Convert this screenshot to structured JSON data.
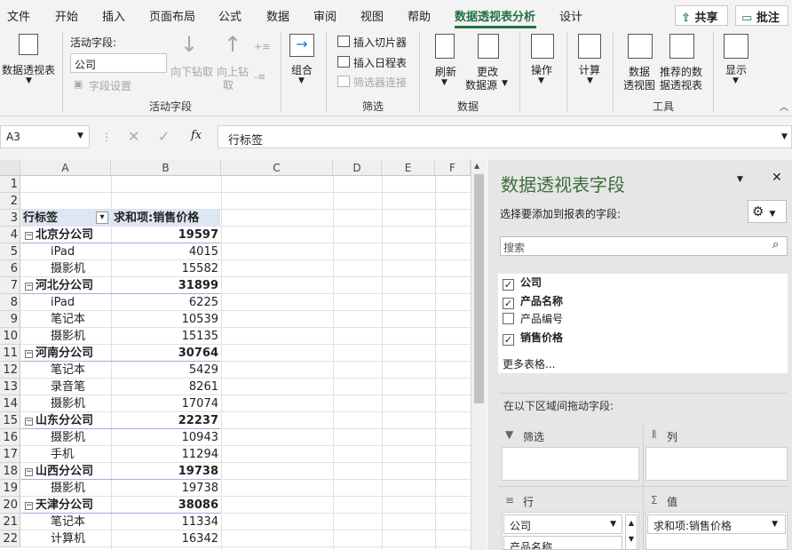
{
  "ribbon_tabs": [
    "文件",
    "开始",
    "插入",
    "页面布局",
    "公式",
    "数据",
    "审阅",
    "视图",
    "帮助",
    "数据透视表分析",
    "设计"
  ],
  "top_buttons": {
    "share": "共享",
    "comment": "批注"
  },
  "ribbon": {
    "pivot_table": "数据透视表",
    "active_field_label": "活动字段:",
    "active_field_value": "公司",
    "drill_down": "向下钻取",
    "drill_up": "向上钻",
    "drill_up_2": "取",
    "field_settings": "字段设置",
    "group_active_field": "活动字段",
    "group_btn": "组合",
    "insert_slicer": "插入切片器",
    "insert_timeline": "插入日程表",
    "filter_connections": "筛选器连接",
    "group_filter": "筛选",
    "refresh": "刷新",
    "change_source_1": "更改",
    "change_source_2": "数据源",
    "group_data": "数据",
    "actions": "操作",
    "calculations": "计算",
    "pivot_chart_1": "数据",
    "pivot_chart_2": "透视图",
    "recommended_1": "推荐的数",
    "recommended_2": "据透视表",
    "group_tools": "工具",
    "show": "显示"
  },
  "formula_bar": {
    "cell_ref": "A3",
    "fx": "fx",
    "content": "行标签"
  },
  "columns": [
    "A",
    "B",
    "C",
    "D",
    "E",
    "F"
  ],
  "rows": [
    {
      "n": "1",
      "a": "",
      "b": "",
      "type": "empty"
    },
    {
      "n": "2",
      "a": "",
      "b": "",
      "type": "empty"
    },
    {
      "n": "3",
      "a": "行标签",
      "b": "求和项:销售价格",
      "type": "header"
    },
    {
      "n": "4",
      "a": "北京分公司",
      "b": "19597",
      "type": "group"
    },
    {
      "n": "5",
      "a": "iPad",
      "b": "4015",
      "type": "item"
    },
    {
      "n": "6",
      "a": "摄影机",
      "b": "15582",
      "type": "item"
    },
    {
      "n": "7",
      "a": "河北分公司",
      "b": "31899",
      "type": "group"
    },
    {
      "n": "8",
      "a": "iPad",
      "b": "6225",
      "type": "item"
    },
    {
      "n": "9",
      "a": "笔记本",
      "b": "10539",
      "type": "item"
    },
    {
      "n": "10",
      "a": "摄影机",
      "b": "15135",
      "type": "item"
    },
    {
      "n": "11",
      "a": "河南分公司",
      "b": "30764",
      "type": "group"
    },
    {
      "n": "12",
      "a": "笔记本",
      "b": "5429",
      "type": "item"
    },
    {
      "n": "13",
      "a": "录音笔",
      "b": "8261",
      "type": "item"
    },
    {
      "n": "14",
      "a": "摄影机",
      "b": "17074",
      "type": "item"
    },
    {
      "n": "15",
      "a": "山东分公司",
      "b": "22237",
      "type": "group"
    },
    {
      "n": "16",
      "a": "摄影机",
      "b": "10943",
      "type": "item"
    },
    {
      "n": "17",
      "a": "手机",
      "b": "11294",
      "type": "item"
    },
    {
      "n": "18",
      "a": "山西分公司",
      "b": "19738",
      "type": "group"
    },
    {
      "n": "19",
      "a": "摄影机",
      "b": "19738",
      "type": "item"
    },
    {
      "n": "20",
      "a": "天津分公司",
      "b": "38086",
      "type": "group"
    },
    {
      "n": "21",
      "a": "笔记本",
      "b": "11334",
      "type": "item"
    },
    {
      "n": "22",
      "a": "计算机",
      "b": "16342",
      "type": "item"
    }
  ],
  "pane": {
    "title": "数据透视表字段",
    "subtitle": "选择要添加到报表的字段:",
    "search_placeholder": "搜索",
    "fields": [
      {
        "label": "公司",
        "checked": true
      },
      {
        "label": "产品名称",
        "checked": true
      },
      {
        "label": "产品编号",
        "checked": false
      },
      {
        "label": "销售价格",
        "checked": true
      }
    ],
    "more_tables": "更多表格...",
    "drag_hint": "在以下区域间拖动字段:",
    "zones": {
      "filter": "筛选",
      "columns": "列",
      "rows": "行",
      "values": "值"
    },
    "row_pills": [
      "公司",
      "产品名称"
    ],
    "value_pill": "求和项:销售价格"
  },
  "colors": {
    "accent": "#217346",
    "pane_title": "#3b6e3b",
    "header_band": "#dde6f3"
  }
}
